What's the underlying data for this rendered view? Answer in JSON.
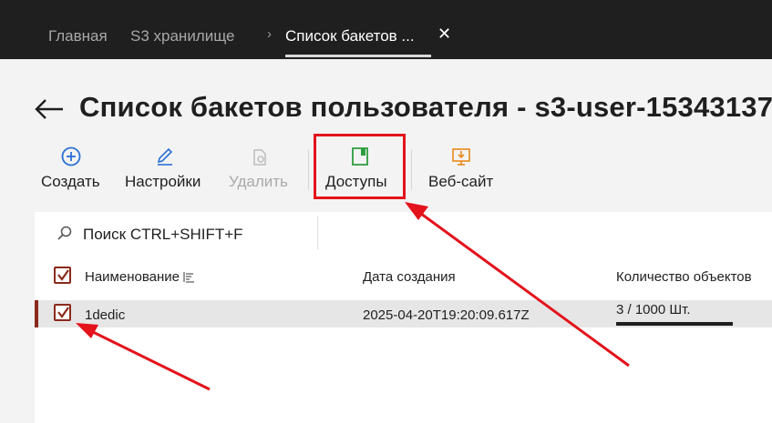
{
  "nav": {
    "tabs": [
      {
        "label": "Главная"
      },
      {
        "label": "S3 хранилище"
      },
      {
        "label": "Список бакетов ..."
      }
    ],
    "breadcrumb_separator": "›",
    "close_glyph": "✕"
  },
  "page": {
    "title": "Список бакетов пользователя - s3-user-15343137"
  },
  "toolbar": {
    "create_label": "Создать",
    "settings_label": "Настройки",
    "delete_label": "Удалить",
    "access_label": "Доступы",
    "website_label": "Веб-сайт"
  },
  "search": {
    "placeholder": "Поиск CTRL+SHIFT+F"
  },
  "table": {
    "columns": [
      "Наименование",
      "Дата создания",
      "Количество объектов"
    ],
    "rows": [
      {
        "name": "1dedic",
        "created": "2025-04-20T19:20:09.617Z",
        "count": "3 / 1000 Шт.",
        "count_fraction": 0.003,
        "checked": true
      }
    ],
    "select_all_checked": true
  },
  "colors": {
    "accent": "#8b2a1a",
    "annotation_red": "#e3121b",
    "create_icon": "#2a6fd6",
    "settings_icon": "#2a6fd6",
    "access_icon": "#2e9e3e",
    "website_icon": "#e8891a"
  },
  "icons": {
    "back": "arrow-left-icon",
    "create": "plus-circle-icon",
    "settings": "pencil-icon",
    "delete": "trash-icon",
    "access": "book-icon",
    "website": "download-monitor-icon",
    "search": "search-icon",
    "sort": "sort-icon"
  }
}
